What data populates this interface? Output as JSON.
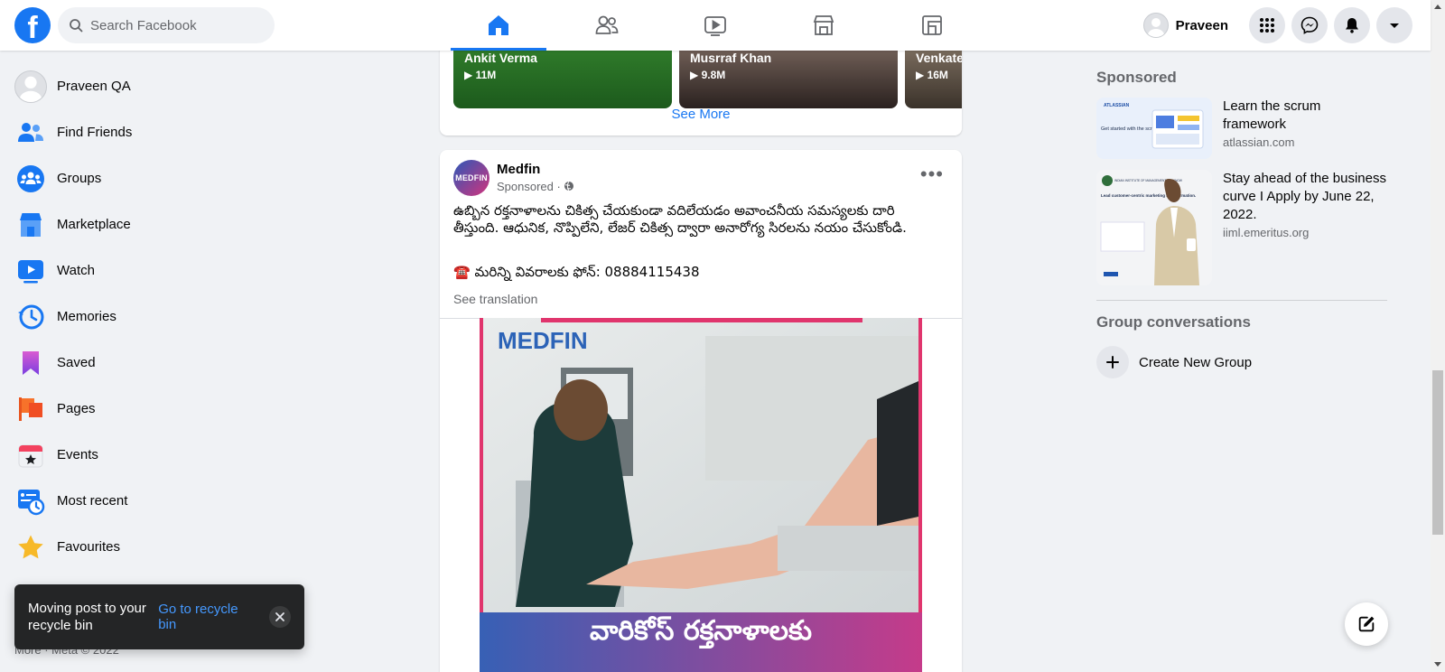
{
  "topbar": {
    "logo": "f",
    "search_placeholder": "Search Facebook",
    "tabs": [
      {
        "name": "home",
        "active": true
      },
      {
        "name": "friends",
        "active": false
      },
      {
        "name": "watch",
        "active": false
      },
      {
        "name": "marketplace",
        "active": false
      },
      {
        "name": "gaming",
        "active": false
      }
    ],
    "profile_name": "Praveen",
    "accent_color": "#1877f2"
  },
  "sidebar": {
    "items": [
      {
        "label": "Praveen QA",
        "icon": "avatar-icon"
      },
      {
        "label": "Find Friends",
        "icon": "friends-icon"
      },
      {
        "label": "Groups",
        "icon": "groups-icon"
      },
      {
        "label": "Marketplace",
        "icon": "marketplace-icon"
      },
      {
        "label": "Watch",
        "icon": "watch-icon"
      },
      {
        "label": "Memories",
        "icon": "memories-icon"
      },
      {
        "label": "Saved",
        "icon": "saved-icon"
      },
      {
        "label": "Pages",
        "icon": "pages-icon"
      },
      {
        "label": "Events",
        "icon": "events-icon"
      },
      {
        "label": "Most recent",
        "icon": "most-recent-icon"
      },
      {
        "label": "Favourites",
        "icon": "star-icon"
      }
    ],
    "footer": "More · Meta © 2022"
  },
  "toast": {
    "message": "Moving post to your recycle bin",
    "link": "Go to recycle bin"
  },
  "reels": {
    "items": [
      {
        "name": "Ankit Verma",
        "views": "11M"
      },
      {
        "name": "Musrraf Khan",
        "views": "9.8M"
      },
      {
        "name": "Venkate",
        "views": "16M"
      }
    ],
    "see_more": "See More"
  },
  "post": {
    "author": "Medfin",
    "avatar_text": "MEDFIN",
    "sponsored": "Sponsored ·",
    "text": "ఉబ్బిన రక్తనాళాలను చికిత్స చేయకుండా వదిలేయడం అవాంచనీయ సమస్యలకు దారి తీస్తుంది. ఆధునిక, నొప్పిలేని, లేజర్ చికిత్స ద్వారా అనారోగ్య సిరలను నయం చేసుకోండి.",
    "phone_line": "☎️ మరిన్ని వివరాలకు ఫోన్: 08884115438",
    "see_translation": "See translation",
    "image_brand": "MEDFIN",
    "image_caption": "వారికోస్ రక్తనాళాలకు"
  },
  "right": {
    "sponsored_title": "Sponsored",
    "ads": [
      {
        "headline": "Learn the scrum framework",
        "source": "atlassian.com",
        "thumb_brand": "ATLASSIAN",
        "thumb_text": "Get started with the scrum framework"
      },
      {
        "headline": "Stay ahead of the business curve I Apply by June 22, 2022.",
        "source": "iiml.emeritus.org",
        "thumb_brand": "INDIAN INSTITUTE OF MANAGEMENT, LUCKNOW",
        "thumb_text": "Lead customer-centric marketing transformation."
      }
    ],
    "group_title": "Group conversations",
    "create_group": "Create New Group"
  }
}
